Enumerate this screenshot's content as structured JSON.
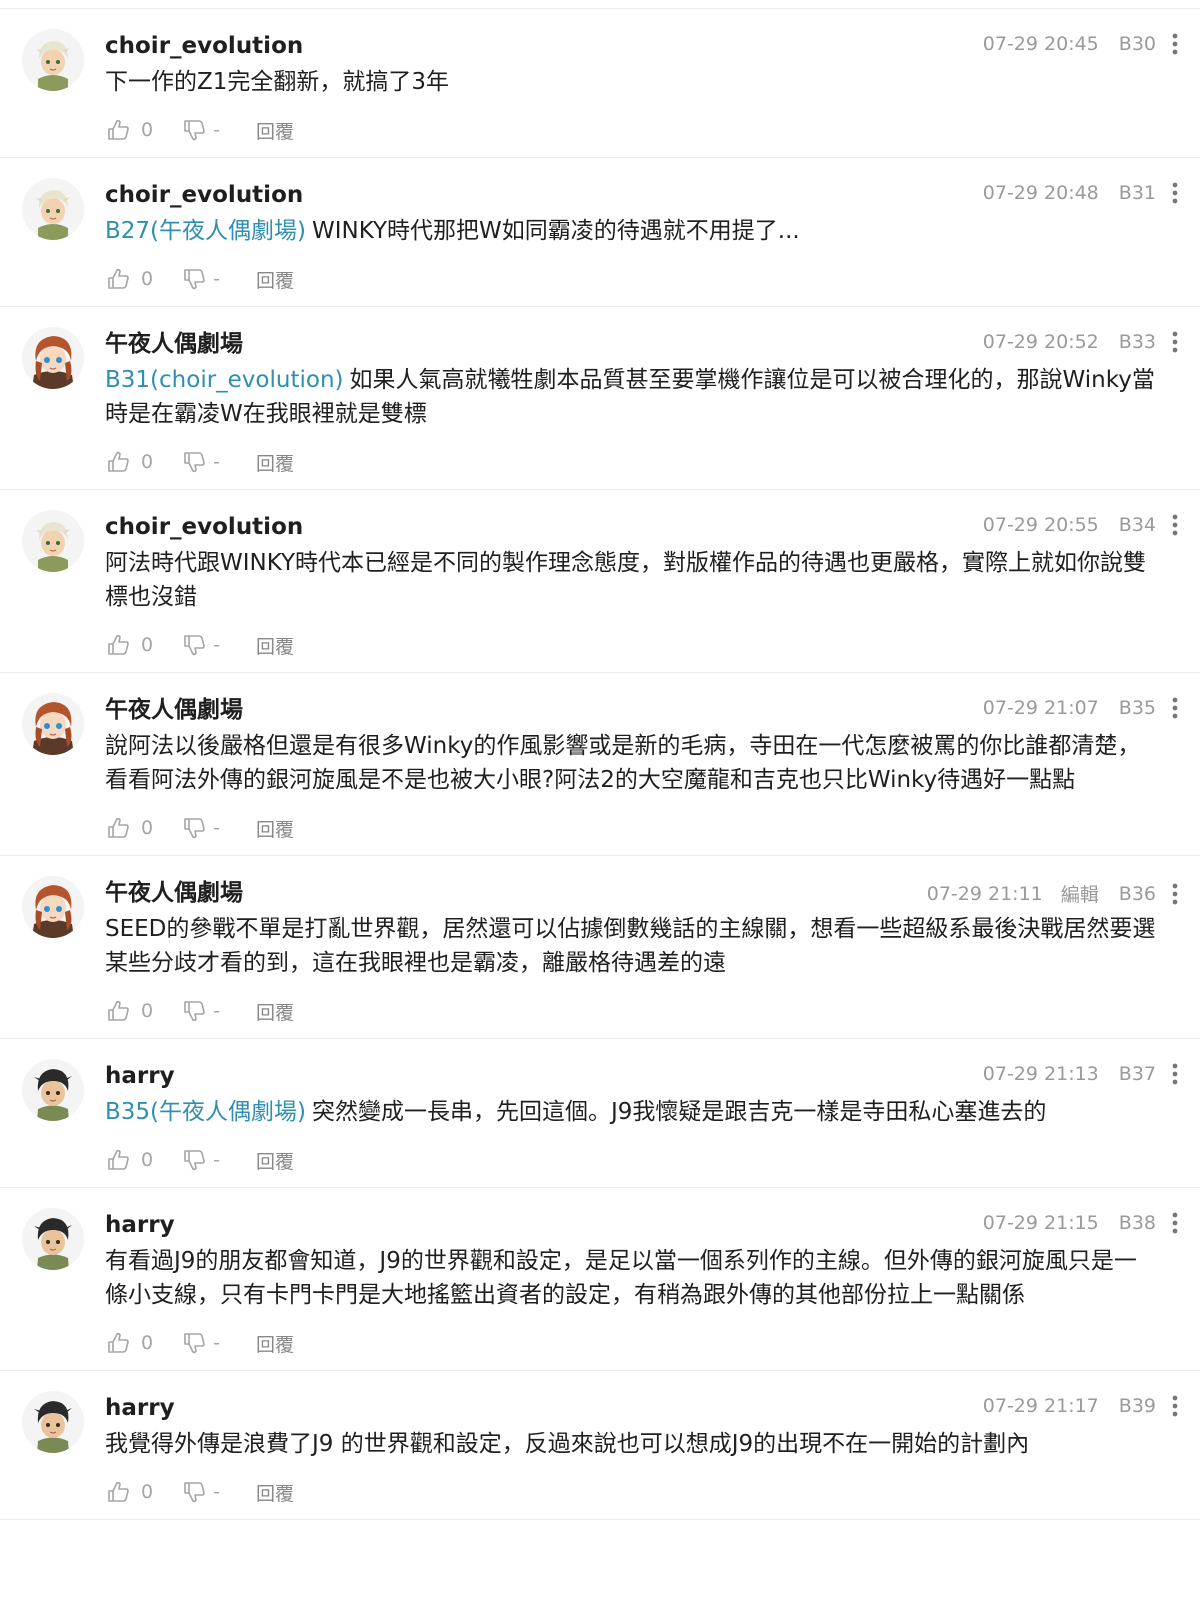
{
  "comments": [
    {
      "author": "choir_evolution",
      "avatar": "avatar-blonde",
      "time": "07-29 20:45",
      "edited": "",
      "floor": "B30",
      "reply_tag": "",
      "text": "下一作的Z1完全翻新，就搞了3年",
      "likes": "0",
      "dislikes": "-",
      "reply_label": "回覆"
    },
    {
      "author": "choir_evolution",
      "avatar": "avatar-blonde",
      "time": "07-29 20:48",
      "edited": "",
      "floor": "B31",
      "reply_tag": "B27(午夜人偶劇場)",
      "text": "WINKY時代那把W如同霸凌的待遇就不用提了...",
      "likes": "0",
      "dislikes": "-",
      "reply_label": "回覆"
    },
    {
      "author": "午夜人偶劇場",
      "avatar": "avatar-redhair",
      "time": "07-29 20:52",
      "edited": "",
      "floor": "B33",
      "reply_tag": "B31(choir_evolution)",
      "text": "如果人氣高就犧牲劇本品質甚至要掌機作讓位是可以被合理化的，那說Winky當時是在霸凌W在我眼裡就是雙標",
      "likes": "0",
      "dislikes": "-",
      "reply_label": "回覆"
    },
    {
      "author": "choir_evolution",
      "avatar": "avatar-blonde",
      "time": "07-29 20:55",
      "edited": "",
      "floor": "B34",
      "reply_tag": "",
      "text": "阿法時代跟WINKY時代本已經是不同的製作理念態度，對版權作品的待遇也更嚴格，實際上就如你說雙標也沒錯",
      "likes": "0",
      "dislikes": "-",
      "reply_label": "回覆"
    },
    {
      "author": "午夜人偶劇場",
      "avatar": "avatar-redhair",
      "time": "07-29 21:07",
      "edited": "",
      "floor": "B35",
      "reply_tag": "",
      "text": "說阿法以後嚴格但還是有很多Winky的作風影響或是新的毛病，寺田在一代怎麼被罵的你比誰都清楚，看看阿法外傳的銀河旋風是不是也被大小眼?阿法2的大空魔龍和吉克也只比Winky待遇好一點點",
      "likes": "0",
      "dislikes": "-",
      "reply_label": "回覆"
    },
    {
      "author": "午夜人偶劇場",
      "avatar": "avatar-redhair",
      "time": "07-29 21:11",
      "edited": "編輯",
      "floor": "B36",
      "reply_tag": "",
      "text": "SEED的參戰不單是打亂世界觀，居然還可以佔據倒數幾話的主線關，想看一些超級系最後決戰居然要選某些分歧才看的到，這在我眼裡也是霸凌，離嚴格待遇差的遠",
      "likes": "0",
      "dislikes": "-",
      "reply_label": "回覆"
    },
    {
      "author": "harry",
      "avatar": "avatar-darkhair",
      "time": "07-29 21:13",
      "edited": "",
      "floor": "B37",
      "reply_tag": "B35(午夜人偶劇場)",
      "text": "突然變成一長串，先回這個。J9我懷疑是跟吉克一樣是寺田私心塞進去的",
      "likes": "0",
      "dislikes": "-",
      "reply_label": "回覆"
    },
    {
      "author": "harry",
      "avatar": "avatar-darkhair",
      "time": "07-29 21:15",
      "edited": "",
      "floor": "B38",
      "reply_tag": "",
      "text": "有看過J9的朋友都會知道，J9的世界觀和設定，是足以當一個系列作的主線。但外傳的銀河旋風只是一條小支線，只有卡門卡門是大地搖籃出資者的設定，有稍為跟外傳的其他部份拉上一點關係",
      "likes": "0",
      "dislikes": "-",
      "reply_label": "回覆"
    },
    {
      "author": "harry",
      "avatar": "avatar-darkhair",
      "time": "07-29 21:17",
      "edited": "",
      "floor": "B39",
      "reply_tag": "",
      "text": "我覺得外傳是浪費了J9 的世界觀和設定，反過來說也可以想成J9的出現不在一開始的計劃內",
      "likes": "0",
      "dislikes": "-",
      "reply_label": "回覆"
    }
  ],
  "colors": {
    "reply_tag": "#2f8fb0",
    "meta_text": "#9a9a9a",
    "action_icon": "#a5a5a5"
  }
}
